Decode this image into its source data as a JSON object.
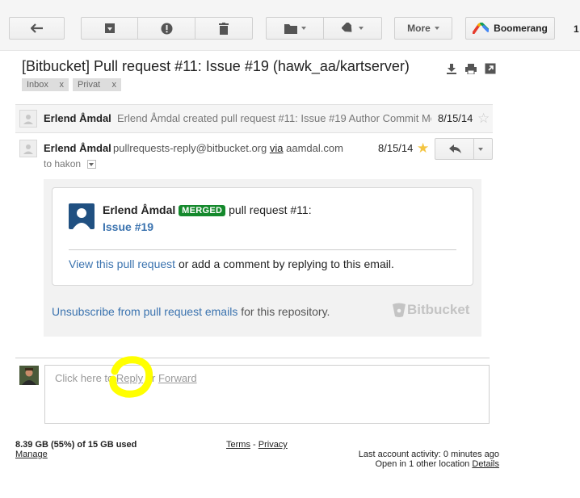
{
  "toolbar": {
    "more_label": "More",
    "boomerang_label": "Boomerang",
    "trailing_number": "1"
  },
  "thread": {
    "subject": "[Bitbucket] Pull request #11: Issue #19 (hawk_aa/kartserver)",
    "labels": [
      {
        "name": "Inbox",
        "remove": "x"
      },
      {
        "name": "Privat",
        "remove": "x"
      }
    ]
  },
  "collapsed_message": {
    "sender": "Erlend Åmdal",
    "snippet": "Erlend Åmdal created pull request #11: Issue #19 Author Commit Me",
    "date": "8/15/14"
  },
  "expanded_message": {
    "sender": "Erlend Åmdal",
    "email": "pullrequests-reply@bitbucket.org",
    "via_label": "via",
    "via_domain": "aamdal.com",
    "date": "8/15/14",
    "to_line": "to hakon",
    "starred_color": "#f4c542"
  },
  "email_body": {
    "author": "Erlend Åmdal",
    "status_badge": "MERGED",
    "action_text": "pull request #11:",
    "issue_link": "Issue #19",
    "view_link": "View this pull request",
    "view_rest": "or add a comment by replying to this email.",
    "unsubscribe_link": "Unsubscribe from pull request emails",
    "unsubscribe_rest": "for this repository.",
    "brand": "Bitbucket",
    "link_color": "#3b73af",
    "badge_color": "#14892c"
  },
  "reply_area": {
    "prompt_prefix": "Click here to",
    "reply_link": "Reply",
    "or_text": "or",
    "forward_link": "Forward",
    "highlight_color": "#ffff00"
  },
  "footer": {
    "storage": "8.39 GB (55%) of 15 GB used",
    "manage": "Manage",
    "terms": "Terms",
    "dash": "-",
    "privacy": "Privacy",
    "last_activity": "Last account activity: 0 minutes ago",
    "open_locations": "Open in 1 other location",
    "details": "Details"
  }
}
